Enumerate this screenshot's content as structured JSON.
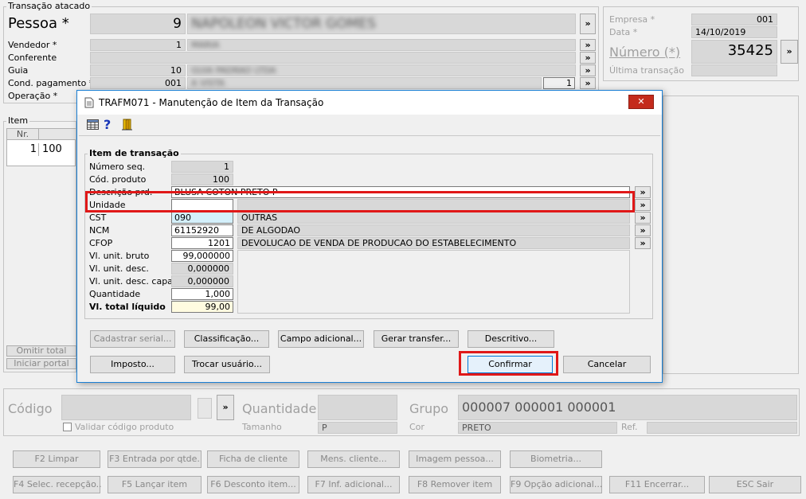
{
  "main": {
    "section_title": "Transação atacado",
    "pessoa_label": "Pessoa *",
    "pessoa_code": "9",
    "pessoa_name": "NAPOLEON VICTOR GOMES",
    "vendedor_label": "Vendedor *",
    "vendedor_code": "1",
    "vendedor_name": "MARIA",
    "conferente_label": "Conferente",
    "guia_label": "Guia",
    "guia_code": "10",
    "guia_name": "GUIA PADRAO LTDA",
    "cond_label": "Cond. pagamento *",
    "cond_code": "001",
    "cond_name": "A VISTA",
    "cond_extra": "1",
    "operacao_label": "Operação *",
    "empresa_label": "Empresa *",
    "empresa_value": "001",
    "data_label": "Data *",
    "data_value": "14/10/2019",
    "numero_label": "Número (*)",
    "numero_value": "35425",
    "ultima_label": "Última transação",
    "item_title": "Item",
    "grid_header_nr": "Nr.",
    "grid_row_nr": "1",
    "grid_row_code": "100",
    "omitir_label": "Omitir total",
    "iniciar_label": "Iniciar portal",
    "codigo_label": "Código",
    "validar_label": "Validar código produto",
    "quantidade_label": "Quantidade",
    "tamanho_label": "Tamanho",
    "tamanho_value": "P",
    "grupo_label": "Grupo",
    "grupo_value": "000007 000001 000001",
    "cor_label": "Cor",
    "cor_value": "PRETO",
    "ref_label": "Ref.",
    "dots": "»"
  },
  "fkeys": [
    [
      "F2 Limpar",
      "F3 Entrada por qtde.",
      "Ficha de cliente",
      "Mens. cliente...",
      "Imagem pessoa...",
      "Biometria..."
    ],
    [
      "F4 Selec. recepção..",
      "F5 Lançar item",
      "F6 Desconto item...",
      "F7 Inf. adicional...",
      "F8 Remover item",
      "F9 Opção adicional...",
      "F11 Encerrar...",
      "ESC Sair"
    ]
  ],
  "dialog": {
    "title": "TRAFM071 - Manutenção de Item da Transação",
    "close": "✕",
    "group_title": "Item de transação",
    "fields": {
      "num_seq_label": "Número seq.",
      "num_seq": "1",
      "cod_prod_label": "Cód. produto",
      "cod_prod": "100",
      "descricao_label": "Descrição prd.",
      "descricao": "BLUSA COTON PRETO P",
      "unidade_label": "Unidade",
      "unidade": "",
      "cst_label": "CST",
      "cst": "090",
      "cst_desc": "OUTRAS",
      "ncm_label": "NCM",
      "ncm": "61152920",
      "ncm_desc": "DE ALGODAO",
      "cfop_label": "CFOP",
      "cfop": "1201",
      "cfop_desc": "DEVOLUCAO DE VENDA DE PRODUCAO DO ESTABELECIMENTO",
      "vl_bruto_label": "Vl. unit. bruto",
      "vl_bruto": "99,000000",
      "vl_desc_label": "Vl. unit. desc.",
      "vl_desc": "0,000000",
      "vl_desc_capa_label": "Vl. unit. desc. capa",
      "vl_desc_capa": "0,000000",
      "quantidade_label": "Quantidade",
      "quantidade": "1,000",
      "vl_total_label": "Vl. total líquido",
      "vl_total": "99,00"
    },
    "buttons": {
      "cadastrar": "Cadastrar serial...",
      "classificacao": "Classificação...",
      "campo": "Campo adicional...",
      "gerar": "Gerar transfer...",
      "descritivo": "Descritivo...",
      "imposto": "Imposto...",
      "trocar": "Trocar usuário...",
      "confirmar": "Confirmar",
      "cancelar": "Cancelar"
    },
    "help_icon": "?"
  },
  "colors": {
    "highlight": "#e01818",
    "title_bar": "#ffffff",
    "dialog_border": "#1a7fd4"
  }
}
